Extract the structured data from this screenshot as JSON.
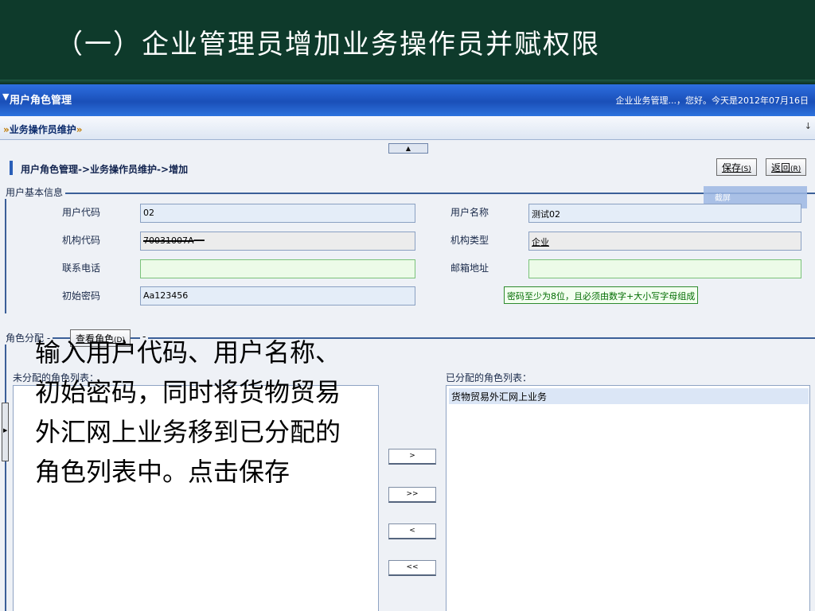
{
  "slide": {
    "title": "（一）企业管理员增加业务操作员并赋权限"
  },
  "app": {
    "title": "用户角色管理",
    "greeting": "企业业务管理...，您好。今天是2012年07月16日",
    "nav_tab": "业务操作员维护",
    "breadcrumb": "用户角色管理->业务操作员维护->增加",
    "save_label": "保存",
    "save_key": "(S)",
    "back_label": "返回",
    "back_key": "(R)",
    "cut_hint": "截屏"
  },
  "basic_info": {
    "legend": "用户基本信息",
    "user_code_label": "用户代码",
    "user_code": "02",
    "user_name_label": "用户名称",
    "user_name": "测试02",
    "org_code_label": "机构代码",
    "org_code": "70031007A",
    "org_type_label": "机构类型",
    "org_type": "企业",
    "phone_label": "联系电话",
    "phone": "",
    "email_label": "邮箱地址",
    "email": "",
    "init_pwd_label": "初始密码",
    "init_pwd": "Aa123456",
    "pwd_hint": "密码至少为8位，且必须由数字+大小写字母组成"
  },
  "roles": {
    "legend": "角色分配",
    "view_label": "查看角色",
    "view_key": "(D)",
    "unassigned_title": "未分配的角色列表：",
    "assigned_title": "已分配的角色列表：",
    "assigned_items": [
      "货物贸易外汇网上业务"
    ],
    "move_right": ">",
    "move_all_right": ">>",
    "move_left": "<",
    "move_all_left": "<<"
  },
  "annotation": "输入用户代码、用户名称、初始密码，同时将货物贸易外汇网上业务移到已分配的角色列表中。点击保存"
}
